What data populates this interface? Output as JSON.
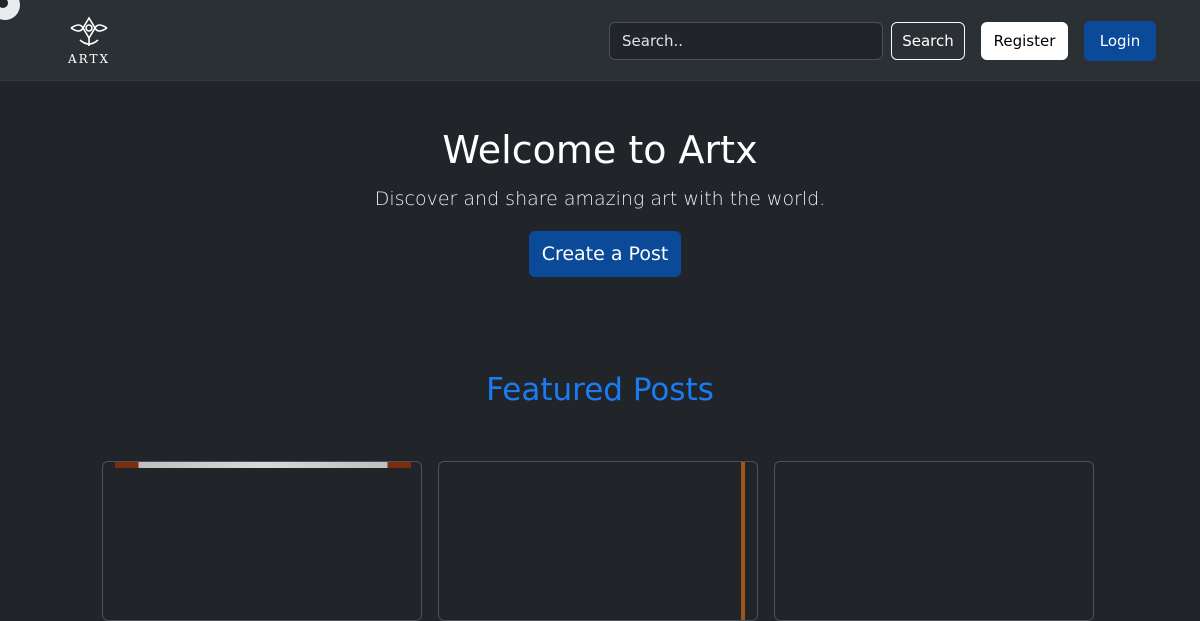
{
  "brand": {
    "name": "ARTX"
  },
  "search": {
    "placeholder": "Search..",
    "button_label": "Search"
  },
  "nav": {
    "register_label": "Register",
    "login_label": "Login"
  },
  "hero": {
    "title": "Welcome to Artx",
    "subtitle": "Discover and share amazing art with the world.",
    "cta_label": "Create a Post"
  },
  "featured": {
    "title": "Featured Posts"
  },
  "colors": {
    "background": "#212529",
    "navbar": "#2b3035",
    "primary": "#0a4a99",
    "accent": "#1a7bf2"
  }
}
